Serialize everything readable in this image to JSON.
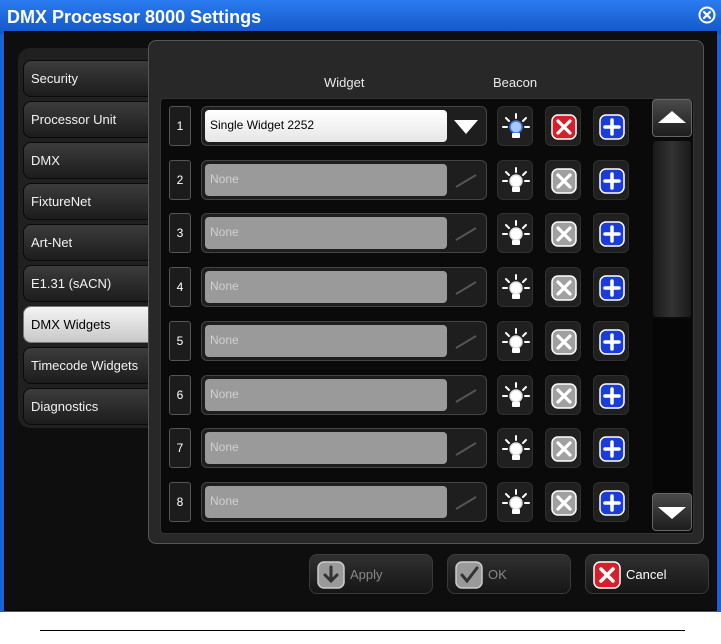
{
  "window": {
    "title": "DMX Processor 8000 Settings",
    "close_icon": "close-circle-icon"
  },
  "sidebar": {
    "items": [
      {
        "label": "Security",
        "active": false
      },
      {
        "label": "Processor Unit",
        "active": false
      },
      {
        "label": "DMX",
        "active": false
      },
      {
        "label": "FixtureNet",
        "active": false
      },
      {
        "label": "Art-Net",
        "active": false
      },
      {
        "label": "E1.31 (sACN)",
        "active": false
      },
      {
        "label": "DMX Widgets",
        "active": true
      },
      {
        "label": "Timecode Widgets",
        "active": false
      },
      {
        "label": "Diagnostics",
        "active": false
      }
    ]
  },
  "grid": {
    "headers": {
      "widget": "Widget",
      "beacon": "Beacon"
    },
    "rows": [
      {
        "num": "1",
        "value": "Single Widget 2252",
        "enabled": true
      },
      {
        "num": "2",
        "value": "None",
        "enabled": false
      },
      {
        "num": "3",
        "value": "None",
        "enabled": false
      },
      {
        "num": "4",
        "value": "None",
        "enabled": false
      },
      {
        "num": "5",
        "value": "None",
        "enabled": false
      },
      {
        "num": "6",
        "value": "None",
        "enabled": false
      },
      {
        "num": "7",
        "value": "None",
        "enabled": false
      },
      {
        "num": "8",
        "value": "None",
        "enabled": false
      }
    ]
  },
  "buttons": {
    "apply": "Apply",
    "ok": "OK",
    "cancel": "Cancel"
  },
  "colors": {
    "title_bar": "#1565d8",
    "accent_blue": "#1a3cd8",
    "remove_red": "#d4202a",
    "disabled_gray": "#9a9a9a"
  }
}
